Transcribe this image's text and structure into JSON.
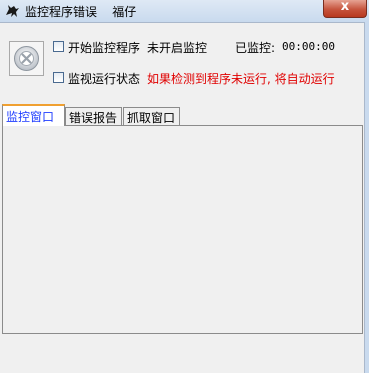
{
  "window": {
    "title": "监控程序错误    福仔",
    "close_symbol": "x"
  },
  "monitor": {
    "start_checkbox_label": "开始监控程序",
    "status_text": "未开启监控",
    "elapsed_label": "已监控:",
    "elapsed_value": "00:00:00",
    "watch_checkbox_label": "监视运行状态",
    "watch_hint": "如果检测到程序未运行, 将自动运行"
  },
  "tabs": [
    {
      "label": "监控窗口",
      "active": true
    },
    {
      "label": "错误报告",
      "active": false
    },
    {
      "label": "抓取窗口",
      "active": false
    }
  ],
  "colors": {
    "hint_red": "#e00000",
    "active_tab_text": "#1e3cff",
    "active_tab_accent": "#f0a030"
  }
}
